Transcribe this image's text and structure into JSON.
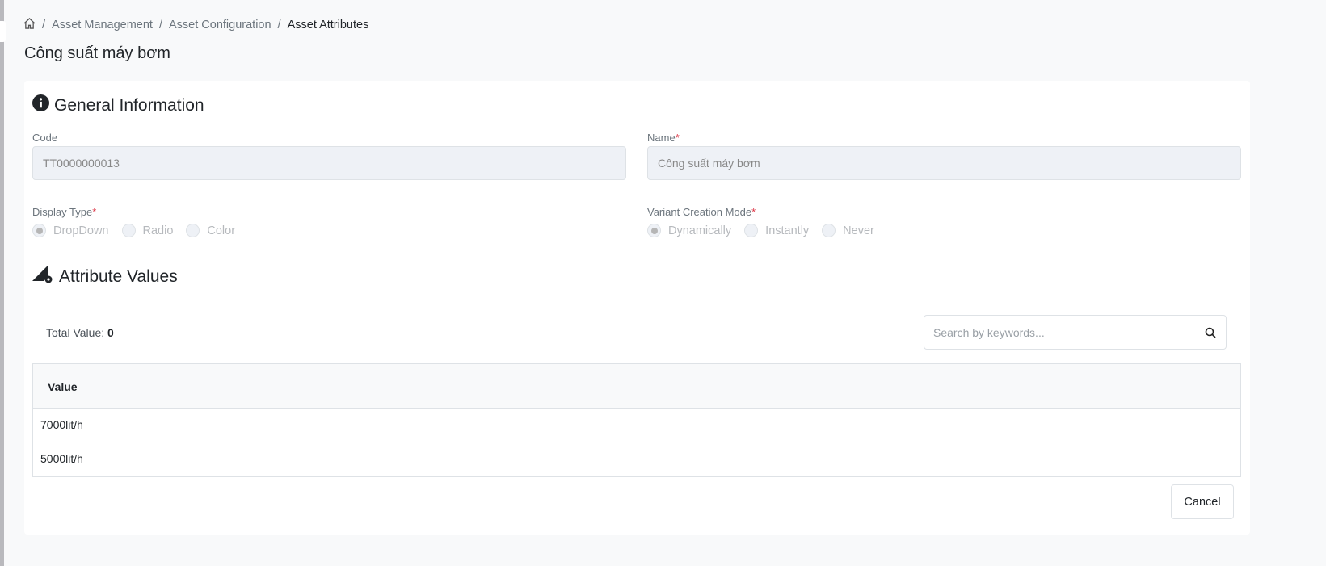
{
  "breadcrumb": {
    "items": [
      "Asset Management",
      "Asset Configuration"
    ],
    "current": "Asset Attributes"
  },
  "page_title": "Công suất máy bơm",
  "general": {
    "title": "General Information",
    "code_label": "Code",
    "code_value": "TT0000000013",
    "name_label": "Name",
    "name_value": "Công suất máy bơm",
    "display_type_label": "Display Type",
    "display_types": [
      "DropDown",
      "Radio",
      "Color"
    ],
    "display_type_selected": "DropDown",
    "variant_label": "Variant Creation Mode",
    "variant_modes": [
      "Dynamically",
      "Instantly",
      "Never"
    ],
    "variant_selected": "Dynamically",
    "required_mark": "*"
  },
  "values": {
    "title": "Attribute Values",
    "total_label": "Total Value:",
    "total_count": "0",
    "search_placeholder": "Search by keywords...",
    "column": "Value",
    "rows": [
      "7000lit/h",
      "5000lit/h"
    ]
  },
  "actions": {
    "cancel": "Cancel"
  }
}
